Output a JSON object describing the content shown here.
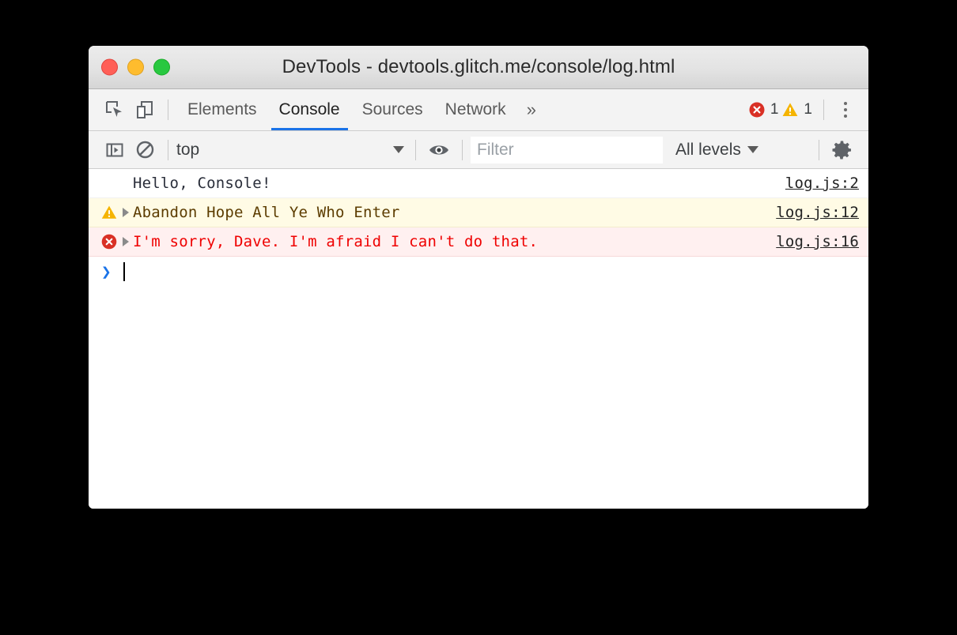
{
  "window": {
    "title": "DevTools - devtools.glitch.me/console/log.html",
    "traffic_lights": [
      {
        "name": "close",
        "color": "#ff5f57"
      },
      {
        "name": "minimize",
        "color": "#febc2e"
      },
      {
        "name": "maximize",
        "color": "#28c840"
      }
    ]
  },
  "tabbar": {
    "icons": [
      {
        "name": "inspect-element-icon"
      },
      {
        "name": "device-toolbar-icon"
      }
    ],
    "tabs": [
      {
        "label": "Elements",
        "active": false
      },
      {
        "label": "Console",
        "active": true
      },
      {
        "label": "Sources",
        "active": false
      },
      {
        "label": "Network",
        "active": false
      }
    ],
    "overflow_label": "»",
    "error_count": "1",
    "warning_count": "1",
    "error_color": "#d93025",
    "warning_color": "#f5b400",
    "more_menu_label": "more-options"
  },
  "filterbar": {
    "sidebar_toggle_icon": "console-sidebar-icon",
    "clear_console_icon": "clear-console-icon",
    "context": "top",
    "eye_icon": "live-expression-eye-icon",
    "filter_placeholder": "Filter",
    "filter_value": "",
    "levels": "All levels",
    "settings_icon": "settings-gear-icon"
  },
  "console": {
    "messages": [
      {
        "level": "log",
        "text": "Hello, Console!",
        "source": "log.js:2",
        "has_disclosure": false,
        "has_icon": false
      },
      {
        "level": "warning",
        "text": "Abandon Hope All Ye Who Enter",
        "source": "log.js:12",
        "has_disclosure": true,
        "has_icon": true
      },
      {
        "level": "error",
        "text": "I'm sorry, Dave. I'm afraid I can't do that.",
        "source": "log.js:16",
        "has_disclosure": true,
        "has_icon": true
      }
    ],
    "prompt_chevron": "❯",
    "prompt_value": ""
  }
}
